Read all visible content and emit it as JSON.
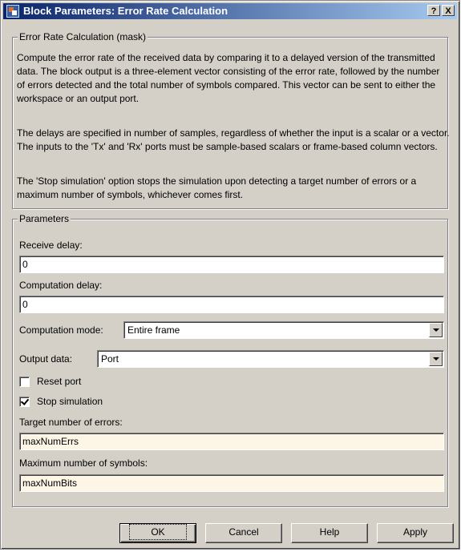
{
  "window": {
    "title": "Block Parameters: Error Rate Calculation",
    "help_glyph": "?",
    "close_glyph": "X"
  },
  "description": {
    "group_label": "Error Rate Calculation (mask)",
    "paragraphs": [
      "Compute the error rate of the received data by comparing it to a delayed version of the transmitted data. The block output is a three-element vector consisting of the error rate, followed by the number of errors detected and the total number of symbols compared. This vector can be sent to either the workspace or an output port.",
      "The delays are specified in number of samples, regardless of whether the input is a scalar or a vector. The inputs to the 'Tx' and 'Rx' ports must be sample-based scalars or frame-based column vectors.",
      "The 'Stop simulation' option stops the simulation upon detecting a target number of errors or a maximum number of symbols, whichever comes first."
    ]
  },
  "parameters": {
    "group_label": "Parameters",
    "receive_delay": {
      "label": "Receive delay:",
      "value": "0"
    },
    "computation_delay": {
      "label": "Computation delay:",
      "value": "0"
    },
    "computation_mode": {
      "label": "Computation mode:",
      "value": "Entire frame"
    },
    "output_data": {
      "label": "Output data:",
      "value": "Port"
    },
    "reset_port": {
      "label": "Reset port",
      "checked": false
    },
    "stop_simulation": {
      "label": "Stop simulation",
      "checked": true
    },
    "target_errors": {
      "label": "Target number of errors:",
      "value": "maxNumErrs"
    },
    "max_symbols": {
      "label": "Maximum number of symbols:",
      "value": "maxNumBits"
    }
  },
  "buttons": {
    "ok": "OK",
    "cancel": "Cancel",
    "help": "Help",
    "apply": "Apply"
  },
  "colors": {
    "dialog_face": "#d4d0c8",
    "title_gradient_start": "#0a246a",
    "title_gradient_end": "#a6caf0",
    "tinted_field": "#fdf5e6"
  },
  "icons": {
    "app": "simulink-block-icon",
    "help": "help-icon",
    "close": "close-icon",
    "dropdown": "chevron-down-icon",
    "check": "check-icon"
  }
}
